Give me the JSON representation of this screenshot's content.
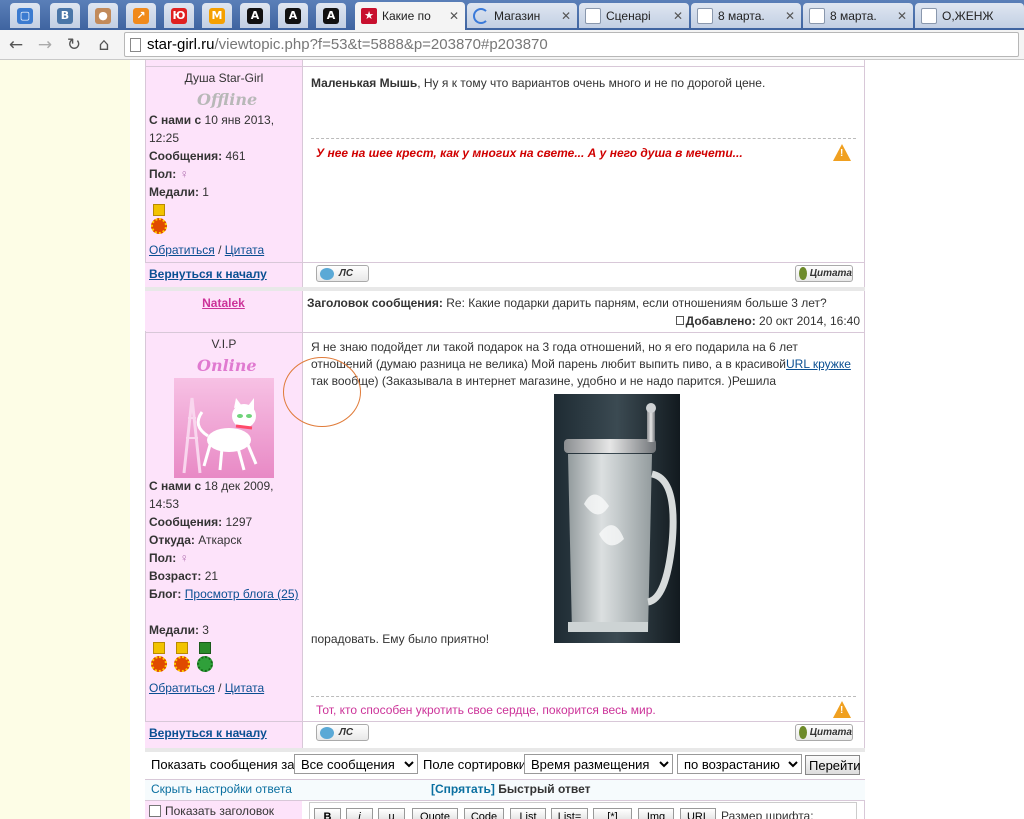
{
  "browser": {
    "pinned_tabs": [
      {
        "icon": "chat-icon",
        "color": "#3b7bd0",
        "glyph": "▢"
      },
      {
        "icon": "vk-icon",
        "color": "#4a76a8",
        "glyph": "В"
      },
      {
        "icon": "dog-icon",
        "color": "#c28a5a",
        "glyph": "●"
      },
      {
        "icon": "chart-icon",
        "color": "#f08a1c",
        "glyph": "↗"
      },
      {
        "icon": "yu-icon",
        "color": "#e02020",
        "glyph": "Ю"
      },
      {
        "icon": "m-icon",
        "color": "#f5a000",
        "glyph": "M"
      },
      {
        "icon": "a-icon",
        "color": "#111111",
        "glyph": "A"
      },
      {
        "icon": "a-icon",
        "color": "#111111",
        "glyph": "A"
      },
      {
        "icon": "a-icon",
        "color": "#111111",
        "glyph": "A"
      },
      {
        "icon": "a-icon",
        "color": "#111111",
        "glyph": "A"
      }
    ],
    "tabs": [
      {
        "title": "Какие по",
        "icon": "star-icon",
        "active": true
      },
      {
        "title": "Магазин",
        "icon": "loading-icon",
        "active": false
      },
      {
        "title": "Сценарі",
        "icon": "page-icon",
        "active": false
      },
      {
        "title": "8 марта.",
        "icon": "page-icon",
        "active": false
      },
      {
        "title": "8 марта.",
        "icon": "page-icon",
        "active": false
      },
      {
        "title": "О,ЖЕНЖ",
        "icon": "page-icon",
        "active": false
      }
    ],
    "url_host": "star-girl.ru",
    "url_path": "/viewtopic.php?f=53&t=5888&p=203870#p203870"
  },
  "post1": {
    "rank": "Душа Star-Girl",
    "status": "Offline",
    "joined_label": "С нами с",
    "joined": " 10 янв 2013, 12:25",
    "messages_label": "Сообщения:",
    "messages": " 461",
    "gender_label": "Пол:",
    "medals_label": "Медали:",
    "medals": " 1",
    "contact": "Обратиться",
    "sep": " / ",
    "quote_link": "Цитата",
    "text_author": "Маленькая Мышь",
    "text": ", Ну я к тому что вариантов очень много и не по дорогой цене.",
    "signature": "У нее на шее крест, как у многих на свете... А у него душа в мечети...",
    "back": "Вернуться к началу",
    "pm_btn": "ЛС",
    "quote_btn": "Цитата"
  },
  "post2": {
    "author": "Natalek",
    "subject_label": "Заголовок сообщения:",
    "subject": " Re: Какие подарки дарить парням, если отношениям больше 3 лет?",
    "added_label": "Добавлено:",
    "added": " 20 окт 2014, 16:40",
    "rank": "V.I.P",
    "status": "Online",
    "joined_label": "С нами с",
    "joined": " 18 дек 2009, 14:53",
    "messages_label": "Сообщения:",
    "messages": " 1297",
    "from_label": "Откуда:",
    "from": " Аткарск",
    "gender_label": "Пол:",
    "age_label": "Возраст:",
    "age": " 21",
    "blog_label": "Блог:",
    "blog_link": "Просмотр блога (25)",
    "medals_label": "Медали:",
    "medals": " 3",
    "contact": "Обратиться",
    "sep": " / ",
    "quote_link": "Цитата",
    "text_a": "Я не знаю подойдет ли такой подарок на 3 года отношений, но я его подарила на 6 лет отношений (думаю разница не велика) Мой парень любит выпить пиво, а в красивой",
    "url_link": "URL кружке",
    "text_b": " так вообще) (Заказывала в интернет магазине, удобно и не надо парится. )Решила",
    "text_c": "порадовать. Ему было приятно!",
    "signature": "Тот, кто способен укротить свое сердце, покорится весь мир.",
    "back": "Вернуться к началу",
    "pm_btn": "ЛС",
    "quote_btn": "Цитата"
  },
  "sort_bar": {
    "show_label": "Показать сообщения за:",
    "show_value": "Все сообщения",
    "sort_label": "Поле сортировки",
    "sort_value": "Время размещения",
    "dir_value": "по возрастанию",
    "go": "Перейти"
  },
  "quick_reply": {
    "hide_settings": "Скрыть настройки ответа",
    "hide_link": "[Спрятать]",
    "title": "Быстрый ответ",
    "show_subject": "Показать заголовок",
    "buttons": [
      "B",
      "i",
      "u",
      "Quote",
      "Code",
      "List",
      "List=",
      "[*]",
      "Img",
      "URL"
    ],
    "font_size_label": "Размер шрифта:"
  },
  "colors": {
    "profile_bg": "#fde3fa",
    "link": "#0a4f92",
    "author": "#cc3399",
    "signature_red": "#d00000",
    "signature_pink": "#cc3399"
  }
}
